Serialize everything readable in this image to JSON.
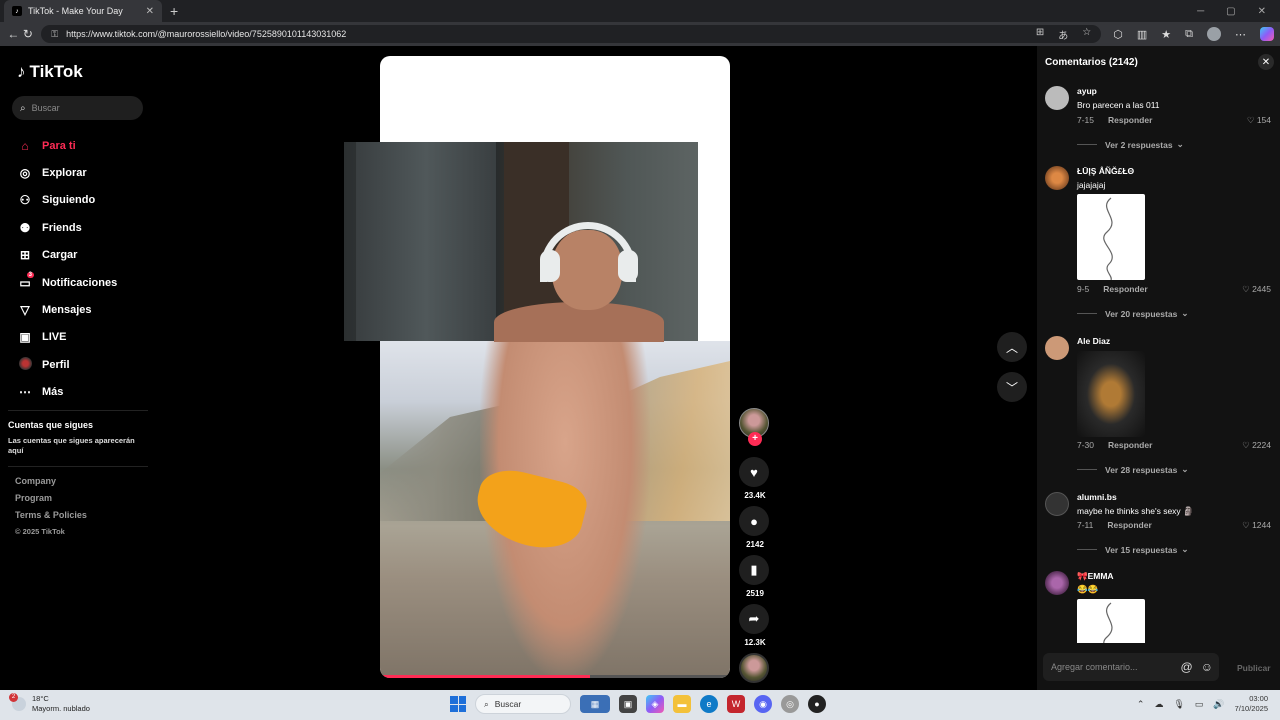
{
  "browser": {
    "tab_title": "TikTok - Make Your Day",
    "tab_close": "✕",
    "new_tab": "+",
    "url": "https://www.tiktok.com/@maurorossiello/video/7525890101143031062"
  },
  "sidebar": {
    "logo": "TikTok",
    "search_placeholder": "Buscar",
    "nav": [
      {
        "label": "Para ti",
        "icon": "home-icon",
        "active": true
      },
      {
        "label": "Explorar",
        "icon": "compass-icon"
      },
      {
        "label": "Siguiendo",
        "icon": "user-follow-icon"
      },
      {
        "label": "Friends",
        "icon": "friends-icon"
      },
      {
        "label": "Cargar",
        "icon": "upload-icon"
      },
      {
        "label": "Notificaciones",
        "icon": "inbox-icon",
        "badge": "3"
      },
      {
        "label": "Mensajes",
        "icon": "send-icon"
      },
      {
        "label": "LIVE",
        "icon": "live-icon"
      },
      {
        "label": "Perfil",
        "icon": "profile-avatar"
      },
      {
        "label": "Más",
        "icon": "more-icon"
      }
    ],
    "following_title": "Cuentas que sigues",
    "following_subtitle": "Las cuentas que sigues aparecerán aquí",
    "footer_links": [
      "Company",
      "Program",
      "Terms & Policies"
    ],
    "copyright": "© 2025 TikTok"
  },
  "video": {
    "progress": 0.6
  },
  "actions": {
    "likes": "23.4K",
    "comments": "2142",
    "saves": "2519",
    "shares": "12.3K"
  },
  "comments_panel": {
    "title": "Comentarios (2142)",
    "input_placeholder": "Agregar comentario...",
    "publish_label": "Publicar",
    "reply_label": "Responder",
    "items": [
      {
        "user": "ayup",
        "text": "Bro parecen a las 011",
        "date": "7-15",
        "likes": "154",
        "replies": "Ver 2 respuestas"
      },
      {
        "user": "ŁŪĮŞ ÅÑĞ£ŁΘ",
        "text": "jajajajaj",
        "date": "9-5",
        "likes": "2445",
        "replies": "Ver 20 respuestas"
      },
      {
        "user": "Ale Diaz",
        "text": "",
        "date": "7-30",
        "likes": "2224",
        "replies": "Ver 28 respuestas"
      },
      {
        "user": "alumni.bs",
        "text": "maybe he thinks she's sexy 🗿",
        "date": "7-11",
        "likes": "1244",
        "replies": "Ver 15 respuestas"
      },
      {
        "user": "🎀EMMA",
        "text": "😂😂",
        "date": "",
        "likes": "",
        "replies": ""
      }
    ]
  },
  "taskbar": {
    "temp": "18°C",
    "weather": "Mayorm. nublado",
    "weather_badge": "2",
    "search": "Buscar",
    "time": "03:00",
    "date": "7/10/2025"
  }
}
